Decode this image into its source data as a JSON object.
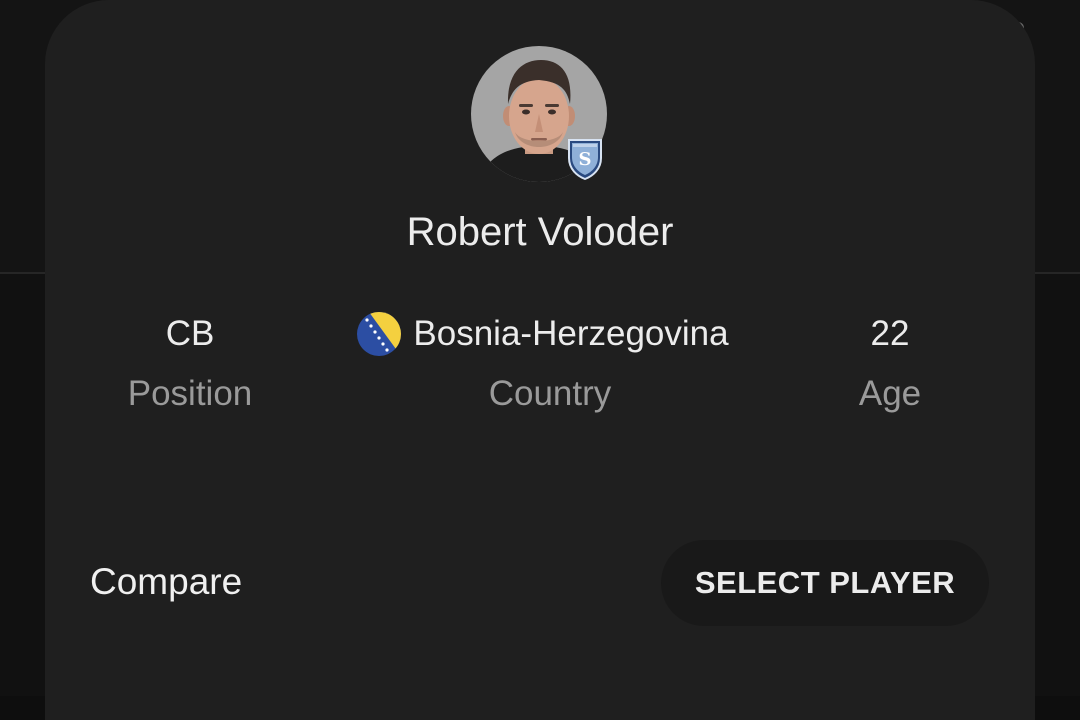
{
  "player": {
    "name": "Robert Voloder",
    "avatar_icon": "player-photo",
    "club_badge_icon": "club-crest-badge"
  },
  "stats": {
    "position": {
      "value": "CB",
      "label": "Position"
    },
    "country": {
      "value": "Bosnia-Herzegovina",
      "label": "Country",
      "flag_icon": "bosnia-herzegovina-flag"
    },
    "age": {
      "value": "22",
      "label": "Age"
    }
  },
  "actions": {
    "compare_label": "Compare",
    "select_player_label": "SELECT PLAYER"
  },
  "colors": {
    "sheet_background": "#1f1f1f",
    "button_background": "#191919",
    "primary_text": "#ececec",
    "secondary_text": "#9a9a9a",
    "flag_blue": "#2c4ea3",
    "flag_yellow": "#f4d03f",
    "badge_blue": "#2a4a80"
  }
}
